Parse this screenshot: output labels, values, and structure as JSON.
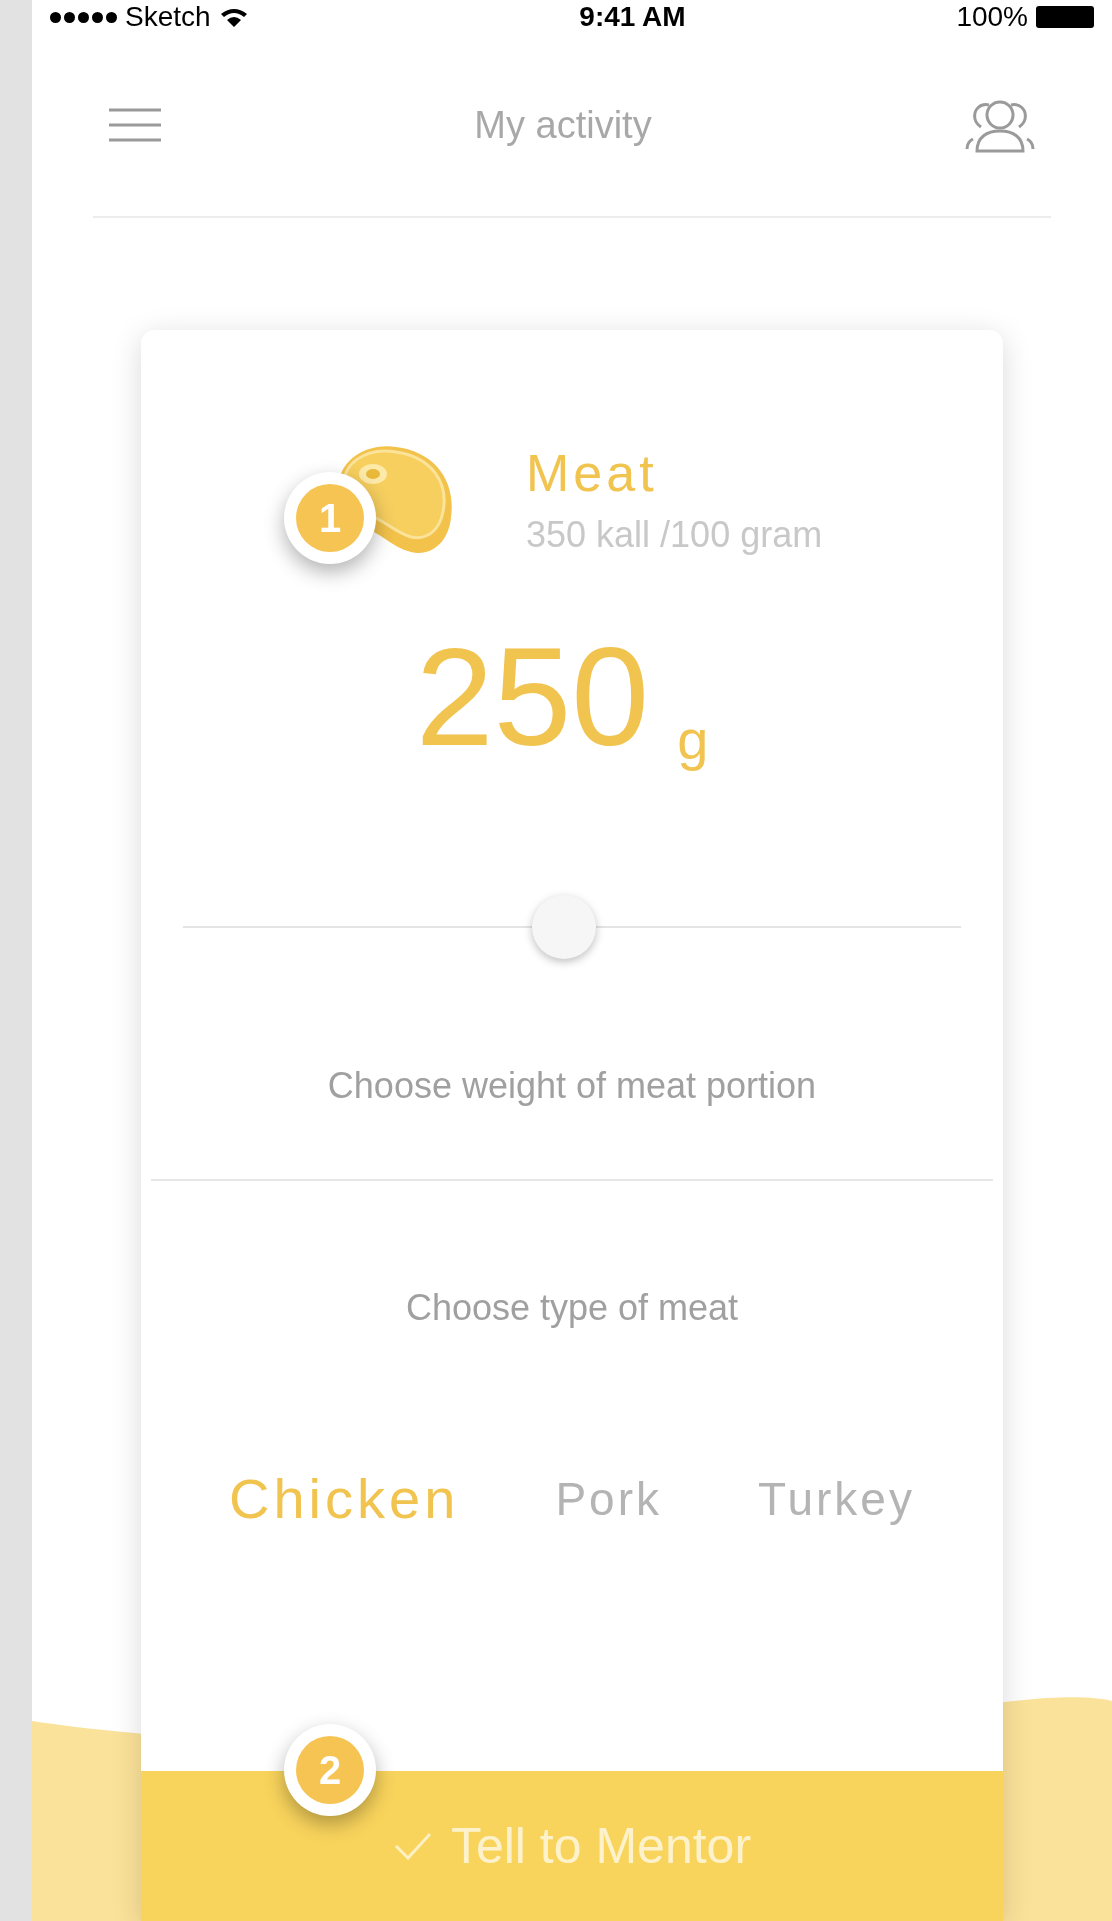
{
  "status_bar": {
    "carrier": "Sketch",
    "time": "9:41 AM",
    "battery": "100%"
  },
  "header": {
    "title": "My activity"
  },
  "card": {
    "name": "Meat",
    "subtitle": "350 kall /100 gram",
    "amount": "250",
    "unit": "g",
    "slider": {
      "level": 0.49
    },
    "slider_label": "Choose weight of meat portion",
    "type_label": "Choose type of meat",
    "options": [
      {
        "label": "Chicken",
        "selected": true
      },
      {
        "label": "Pork",
        "selected": false
      },
      {
        "label": "Turkey",
        "selected": false
      }
    ],
    "button": "Tell to Mentor"
  },
  "annotations": [
    "1",
    "2"
  ]
}
